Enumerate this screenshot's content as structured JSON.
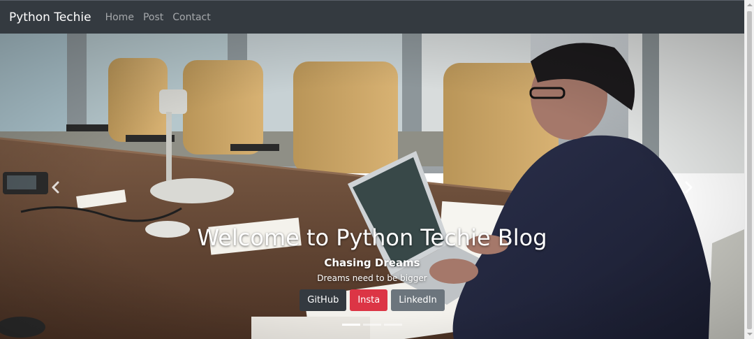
{
  "navbar": {
    "brand": "Python Techie",
    "links": [
      "Home",
      "Post",
      "Contact"
    ]
  },
  "carousel": {
    "title": "Welcome to Python Techie Blog",
    "subtitle": "Chasing Dreams",
    "text": "Dreams need to be bigger",
    "buttons": [
      {
        "label": "GitHub",
        "color": "#343a40"
      },
      {
        "label": "Insta",
        "color": "#dc3545"
      },
      {
        "label": "LinkedIn",
        "color": "#6c757d"
      }
    ],
    "indicator_count": 3,
    "active_indicator": 0,
    "prev_icon": "chevron-left-icon",
    "next_icon": "chevron-right-icon"
  },
  "colors": {
    "navbar_bg": "#343a40",
    "brand": "#ffffff",
    "nav_link": "rgba(255,255,255,0.55)"
  }
}
